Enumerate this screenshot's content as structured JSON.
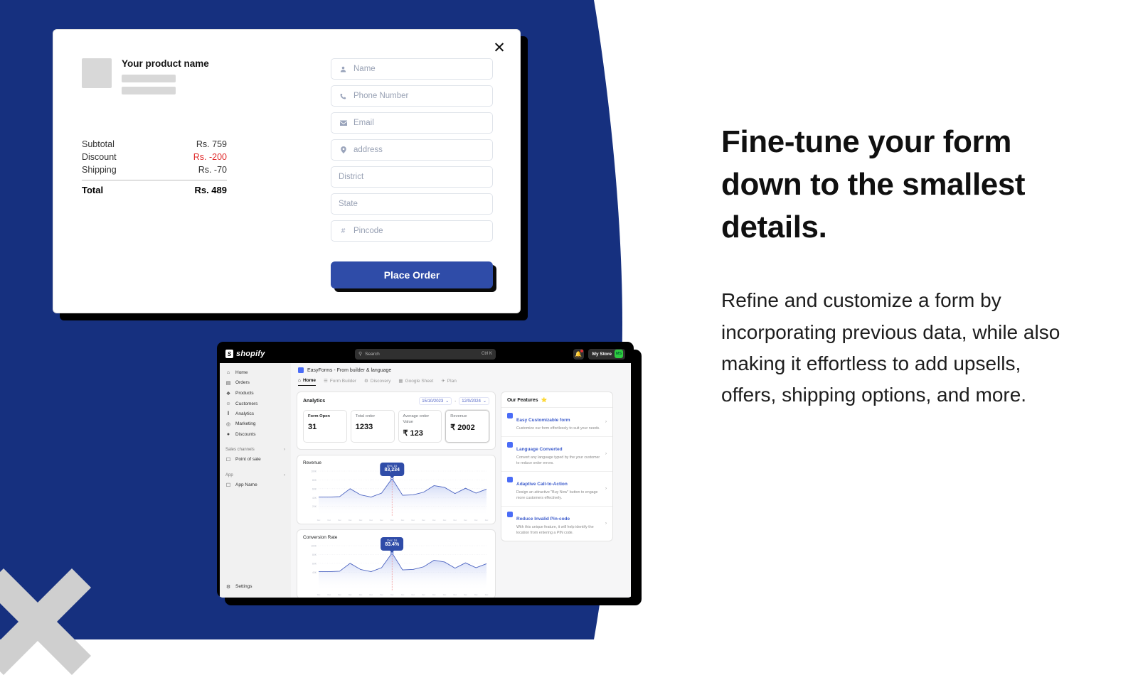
{
  "theme": {
    "brand_blue": "#16307f",
    "button_blue": "#2f4ca8",
    "accent_red": "#e02b2b",
    "deco_gray": "#cfcfcf"
  },
  "checkout": {
    "close_label": "✕",
    "product_name": "Your product name",
    "totals": [
      {
        "label": "Subtotal",
        "amount": "Rs. 759",
        "type": "normal"
      },
      {
        "label": "Discount",
        "amount": "Rs. -200",
        "type": "discount"
      },
      {
        "label": "Shipping",
        "amount": "Rs. -70",
        "type": "normal"
      },
      {
        "label": "Total",
        "amount": "Rs.  489",
        "type": "grand"
      }
    ],
    "fields": [
      {
        "icon": "user-icon",
        "glyph": "👤",
        "placeholder": "Name"
      },
      {
        "icon": "phone-icon",
        "glyph": "☎",
        "placeholder": "Phone Number"
      },
      {
        "icon": "envelope-icon",
        "glyph": "✉",
        "placeholder": "Email"
      },
      {
        "icon": "location-pin-icon",
        "glyph": "📍",
        "placeholder": "address"
      },
      {
        "icon": "none",
        "glyph": "",
        "placeholder": "District"
      },
      {
        "icon": "none",
        "glyph": "",
        "placeholder": "State"
      },
      {
        "icon": "hash-icon",
        "glyph": "#",
        "placeholder": "Pincode"
      }
    ],
    "submit_label": "Place Order"
  },
  "admin": {
    "topbar": {
      "logo_text": "shopify",
      "logo_mark": "S",
      "search_placeholder": "Search",
      "search_shortcut": "Ctrl K",
      "bell_icon": "bell-icon",
      "store_name": "My Store",
      "store_initials": "MS"
    },
    "sidebar": {
      "items": [
        {
          "label": "Home",
          "icon": "home-icon",
          "glyph": "⌂"
        },
        {
          "label": "Orders",
          "icon": "orders-icon",
          "glyph": "▤"
        },
        {
          "label": "Products",
          "icon": "products-icon",
          "glyph": "❖"
        },
        {
          "label": "Customers",
          "icon": "customers-icon",
          "glyph": "☺"
        },
        {
          "label": "Analytics",
          "icon": "analytics-icon",
          "glyph": "‖"
        },
        {
          "label": "Marketing",
          "icon": "marketing-icon",
          "glyph": "◎"
        },
        {
          "label": "Discounts",
          "icon": "discounts-icon",
          "glyph": "●"
        }
      ],
      "group_sales_channels": "Sales channels",
      "point_of_sale": "Point of sale",
      "group_app": "App",
      "app_name": "App Name",
      "settings": "Settings",
      "chevron": "›"
    },
    "page": {
      "title": "EasyForms - From builder & language",
      "tabs": [
        {
          "label": "Home",
          "icon": "home-icon",
          "glyph": "⌂",
          "active": true
        },
        {
          "label": "Form Builder",
          "icon": "document-icon",
          "glyph": "☰",
          "active": false
        },
        {
          "label": "Discovery",
          "icon": "gear-icon",
          "glyph": "⚙",
          "active": false
        },
        {
          "label": "Google Sheet",
          "icon": "grid-icon",
          "glyph": "▦",
          "active": false
        },
        {
          "label": "Plan",
          "icon": "rocket-icon",
          "glyph": "✈",
          "active": false
        }
      ]
    },
    "analytics": {
      "title": "Analytics",
      "date_from": "15/10/2023",
      "date_to": "12/0/2024",
      "date_separator": "-",
      "chevron": "⌄",
      "stats": [
        {
          "label": "Form Open",
          "value": "31",
          "emphasis": true
        },
        {
          "label": "Total order",
          "value": "1233",
          "emphasis": false
        },
        {
          "label": "Average order Value",
          "value": "₹ 123",
          "emphasis": false
        },
        {
          "label": "Revenue",
          "value": "₹ 2002",
          "emphasis": false,
          "highlight": true
        }
      ]
    },
    "features": {
      "title": "Our Features",
      "star": "⭐",
      "chevron": "›",
      "items": [
        {
          "name": "Easy Customizable form",
          "desc": "Customize our form effortlessly to suit your needs.",
          "icon": "document-icon"
        },
        {
          "name": "Language Converted",
          "desc": "Convert any language typed by the your customer to reduce order errors.",
          "icon": "translate-icon"
        },
        {
          "name": "Adaptive Call-to-Action",
          "desc": "Design an attractive \"Buy Now\" button to engage more customers effectively.",
          "icon": "cursor-icon"
        },
        {
          "name": "Reduce Invalid Pin-code",
          "desc": "With this unique feature, it will help identify the location from entering a PIN code.",
          "icon": "pin-icon"
        }
      ]
    }
  },
  "chart_data": [
    {
      "type": "area",
      "title": "Revenue",
      "xlabel": "",
      "ylabel": "",
      "ylim": [
        0,
        100000
      ],
      "ytick_labels": [
        "100K",
        "80K",
        "60K",
        "40K",
        "20K"
      ],
      "ytick_values": [
        100000,
        80000,
        60000,
        40000,
        20000
      ],
      "grid": true,
      "legend": "none",
      "highlight": {
        "x_index": 7,
        "date_label": "Dec 16",
        "value_label": "83,234",
        "value": 83234
      },
      "series": [
        {
          "name": "Revenue",
          "values": [
            41000,
            41000,
            42000,
            60000,
            46000,
            41000,
            50000,
            83234,
            45000,
            46000,
            52000,
            67000,
            63000,
            49000,
            61000,
            50000,
            59000
          ]
        }
      ]
    },
    {
      "type": "area",
      "title": "Conversion Rate",
      "xlabel": "",
      "ylabel": "",
      "ylim": [
        0,
        100
      ],
      "ytick_labels": [
        "100K",
        "80K",
        "60K",
        "40K"
      ],
      "ytick_values": [
        100,
        80,
        60,
        40
      ],
      "grid": true,
      "legend": "none",
      "highlight": {
        "x_index": 7,
        "date_label": "Dec 16",
        "value_label": "83.4%",
        "value": 83.4
      },
      "series": [
        {
          "name": "Conversion Rate",
          "values": [
            41,
            41,
            42,
            60,
            46,
            41,
            50,
            83.4,
            45,
            46,
            52,
            67,
            63,
            49,
            61,
            50,
            59
          ]
        }
      ]
    }
  ],
  "marketing": {
    "headline": "Fine-tune your form down to the smallest details.",
    "body": "Refine and customize a form by incorporating previous data, while also making it effortless to add upsells, offers, shipping options, and more."
  }
}
